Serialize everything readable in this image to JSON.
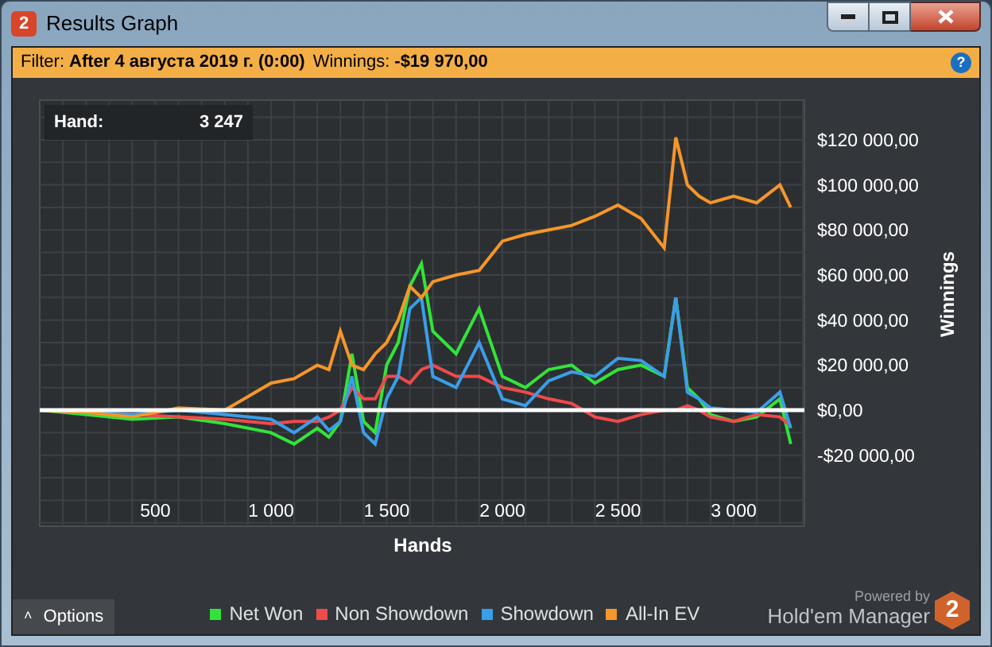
{
  "window": {
    "logo": "2",
    "title": "Results Graph"
  },
  "filter_bar": {
    "label": "Filter:",
    "filter": "After 4 августа 2019 г. (0:00)",
    "winnings_label": "Winnings:",
    "winnings": "-$19 970,00",
    "help": "?"
  },
  "tooltip": {
    "label": "Hand:",
    "value": "3 247"
  },
  "chart_data": {
    "type": "line",
    "xlabel": "Hands",
    "ylabel": "Winnings",
    "x": [
      0,
      200,
      400,
      600,
      800,
      1000,
      1100,
      1200,
      1250,
      1300,
      1350,
      1400,
      1450,
      1500,
      1550,
      1600,
      1650,
      1700,
      1800,
      1900,
      2000,
      2100,
      2200,
      2300,
      2400,
      2500,
      2600,
      2700,
      2750,
      2800,
      2850,
      2900,
      3000,
      3100,
      3200,
      3247
    ],
    "series": [
      {
        "name": "Net Won",
        "color": "#33e33a",
        "values": [
          0,
          -2000,
          -4000,
          -3000,
          -6000,
          -10000,
          -15000,
          -8000,
          -12000,
          -5000,
          25000,
          -5000,
          -10000,
          20000,
          30000,
          55000,
          65000,
          35000,
          25000,
          45000,
          15000,
          10000,
          18000,
          20000,
          12000,
          18000,
          20000,
          15000,
          50000,
          10000,
          5000,
          -2000,
          -5000,
          -3000,
          5000,
          -15000
        ]
      },
      {
        "name": "Non Showdown",
        "color": "#f04a4a",
        "values": [
          0,
          -1000,
          -2000,
          -3000,
          -4000,
          -6000,
          -5000,
          -5000,
          -3000,
          0,
          10000,
          5000,
          5000,
          15000,
          15000,
          12000,
          18000,
          20000,
          15000,
          15000,
          10000,
          8000,
          5000,
          3000,
          -3000,
          -5000,
          -2000,
          0,
          0,
          2000,
          0,
          -3000,
          -5000,
          -2000,
          -3000,
          -7000
        ]
      },
      {
        "name": "Showdown",
        "color": "#3a9ee8",
        "values": [
          0,
          null,
          -2000,
          0,
          -2000,
          -4000,
          -10000,
          -3000,
          -9000,
          -5000,
          15000,
          -10000,
          -15000,
          5000,
          15000,
          45000,
          50000,
          15000,
          10000,
          30000,
          5000,
          2000,
          13000,
          17000,
          15000,
          23000,
          22000,
          15000,
          50000,
          8000,
          5000,
          1000,
          0,
          -1000,
          8000,
          -8000
        ]
      },
      {
        "name": "All-In EV",
        "color": "#f5962a",
        "values": [
          0,
          -1000,
          -3000,
          1000,
          0,
          12000,
          14000,
          20000,
          18000,
          35000,
          20000,
          18000,
          25000,
          30000,
          40000,
          55000,
          50000,
          57000,
          60000,
          62000,
          75000,
          78000,
          80000,
          82000,
          86000,
          91000,
          85000,
          72000,
          121000,
          100000,
          95000,
          92000,
          95000,
          92000,
          100000,
          90000
        ]
      }
    ],
    "xlim": [
      0,
      3306
    ],
    "ylim": [
      -51500,
      137600
    ],
    "grid": true,
    "xticks": [
      {
        "value": 500,
        "label": "500"
      },
      {
        "value": 1000,
        "label": "1 000"
      },
      {
        "value": 1500,
        "label": "1 500"
      },
      {
        "value": 2000,
        "label": "2 000"
      },
      {
        "value": 2500,
        "label": "2 500"
      },
      {
        "value": 3000,
        "label": "3 000"
      }
    ],
    "yticks": [
      {
        "value": 120000,
        "label": "$120 000,00"
      },
      {
        "value": 100000,
        "label": "$100 000,00"
      },
      {
        "value": 80000,
        "label": "$80 000,00"
      },
      {
        "value": 60000,
        "label": "$60 000,00"
      },
      {
        "value": 40000,
        "label": "$40 000,00"
      },
      {
        "value": 20000,
        "label": "$20 000,00"
      },
      {
        "value": 0,
        "label": "$0,00"
      },
      {
        "value": -20000,
        "label": "-$20 000,00"
      }
    ]
  },
  "options_button": {
    "caret": "˄",
    "label": "Options"
  },
  "branding": {
    "powered_by": "Powered by",
    "product": "Hold'em Manager",
    "logo": "2"
  }
}
